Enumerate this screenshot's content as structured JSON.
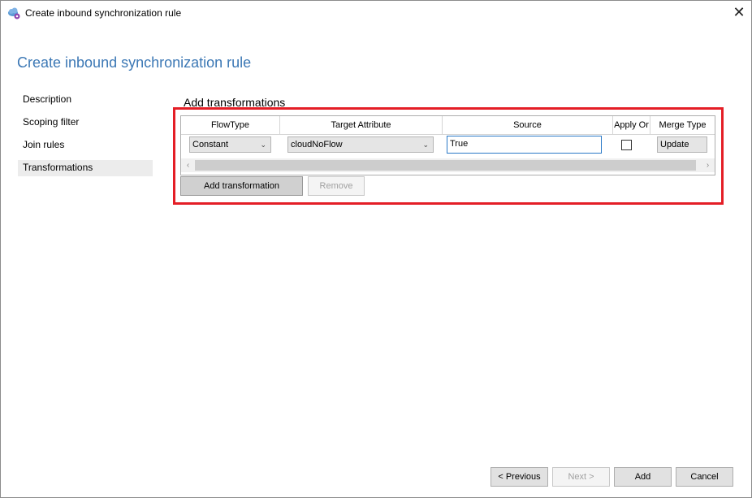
{
  "window": {
    "title": "Create inbound synchronization rule",
    "close_glyph": "✕"
  },
  "page": {
    "heading": "Create inbound synchronization rule"
  },
  "nav": {
    "items": [
      {
        "label": "Description",
        "selected": false
      },
      {
        "label": "Scoping filter",
        "selected": false
      },
      {
        "label": "Join rules",
        "selected": false
      },
      {
        "label": "Transformations",
        "selected": true
      }
    ]
  },
  "section": {
    "title": "Add transformations"
  },
  "grid": {
    "columns": [
      "FlowType",
      "Target Attribute",
      "Source",
      "Apply Or",
      "Merge Type"
    ],
    "rows": [
      {
        "flow_type": "Constant",
        "target_attribute": "cloudNoFlow",
        "source": "True",
        "apply_once": false,
        "merge_type": "Update"
      }
    ],
    "scroll_left_glyph": "‹",
    "scroll_right_glyph": "›",
    "dropdown_glyph": "⌄"
  },
  "buttons": {
    "add_transformation": "Add transformation",
    "remove": "Remove",
    "previous": "< Previous",
    "next": "Next >",
    "add": "Add",
    "cancel": "Cancel"
  },
  "colors": {
    "accent": "#3c78b5",
    "highlight_border": "#e41e26"
  },
  "icons": {
    "app": "sync-cloud-icon",
    "close": "close-icon"
  }
}
